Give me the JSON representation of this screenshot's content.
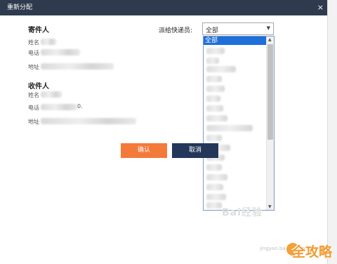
{
  "dialog": {
    "title": "重新分配",
    "close_glyph": "×"
  },
  "sender": {
    "heading": "寄件人",
    "name_label": "姓名",
    "phone_label": "电话",
    "address_label": "地址"
  },
  "recipient": {
    "heading": "收件人",
    "name_label": "姓名",
    "phone_label": "电话",
    "phone_tail": "0.",
    "address_label": "地址"
  },
  "courier": {
    "label": "派给快递员:",
    "selected_value": "全部",
    "dropdown_arrow": "▼",
    "options": [
      "全部"
    ]
  },
  "buttons": {
    "confirm": "确认",
    "cancel": "取消"
  },
  "scrollbar": {
    "up_glyph": "▲",
    "down_glyph": "▼"
  },
  "watermarks": {
    "baidu": "Bai经验",
    "url": "jingyan.baidu.com",
    "corner": "全攻略"
  },
  "colors": {
    "titlebar": "#2e3b4e",
    "confirm_button": "#f47a3a",
    "cancel_button": "#24375a",
    "selected_option": "#1e6fd9"
  }
}
